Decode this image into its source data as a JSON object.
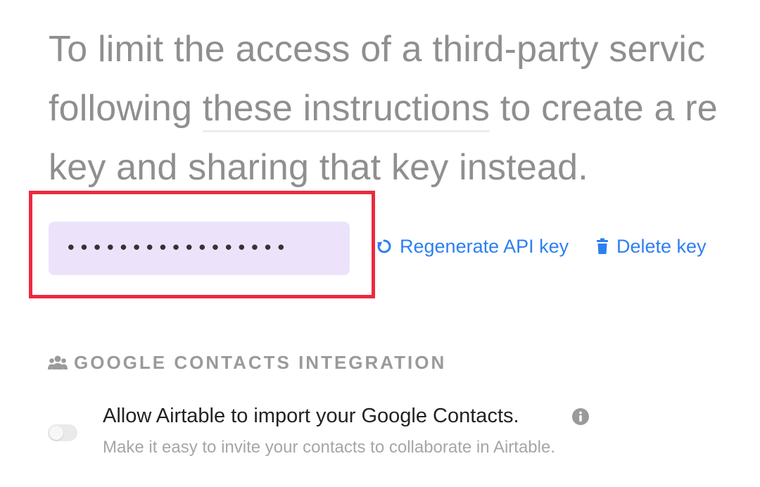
{
  "intro": {
    "line1": "To limit the access of a third-party servic",
    "line2_before": "following ",
    "line2_link": "these instructions",
    "line2_after": " to create a re",
    "line3": "key and sharing that key instead."
  },
  "api_key": {
    "value": "•••••••••••••••••",
    "highlight_color": "#ec2a3f",
    "field_color": "#ece3fb"
  },
  "actions": {
    "regenerate_label": "Regenerate API key",
    "regenerate_icon": "refresh-icon",
    "delete_label": "Delete key",
    "delete_icon": "trash-icon",
    "link_color": "#2d7ff0"
  },
  "google_contacts": {
    "section_icon": "users-icon",
    "section_title": "GOOGLE CONTACTS INTEGRATION",
    "toggle_on": false,
    "title": "Allow Airtable to import your Google Contacts.",
    "info_icon": "info-icon",
    "description": "Make it easy to invite your contacts to collaborate in Airtable."
  }
}
